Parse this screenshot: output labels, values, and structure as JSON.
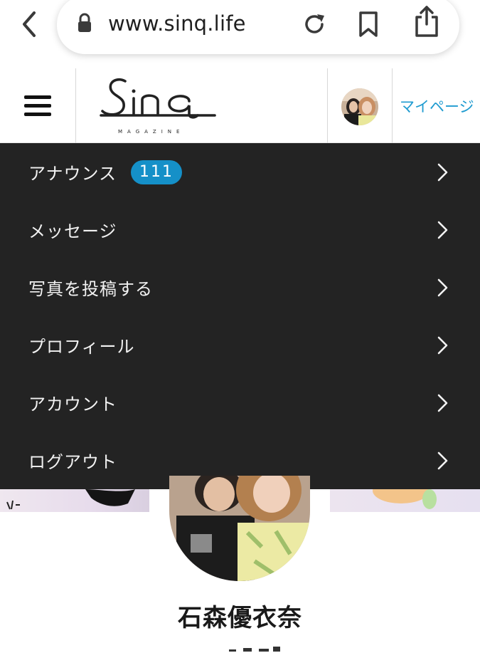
{
  "browser": {
    "url": "www.sinq.life"
  },
  "header": {
    "logo_text": "Sinq",
    "logo_subtext": "MAGAZINE",
    "mypage_label": "マイページ"
  },
  "menu": {
    "items": [
      {
        "label": "アナウンス",
        "badge": "111"
      },
      {
        "label": "メッセージ"
      },
      {
        "label": "写真を投稿する"
      },
      {
        "label": "プロフィール"
      },
      {
        "label": "アカウント"
      },
      {
        "label": "ログアウト"
      }
    ]
  },
  "profile": {
    "name": "石森優衣奈"
  },
  "colors": {
    "menu_bg": "#232323",
    "badge_bg": "#1590c8",
    "link": "#1f9bd0"
  }
}
